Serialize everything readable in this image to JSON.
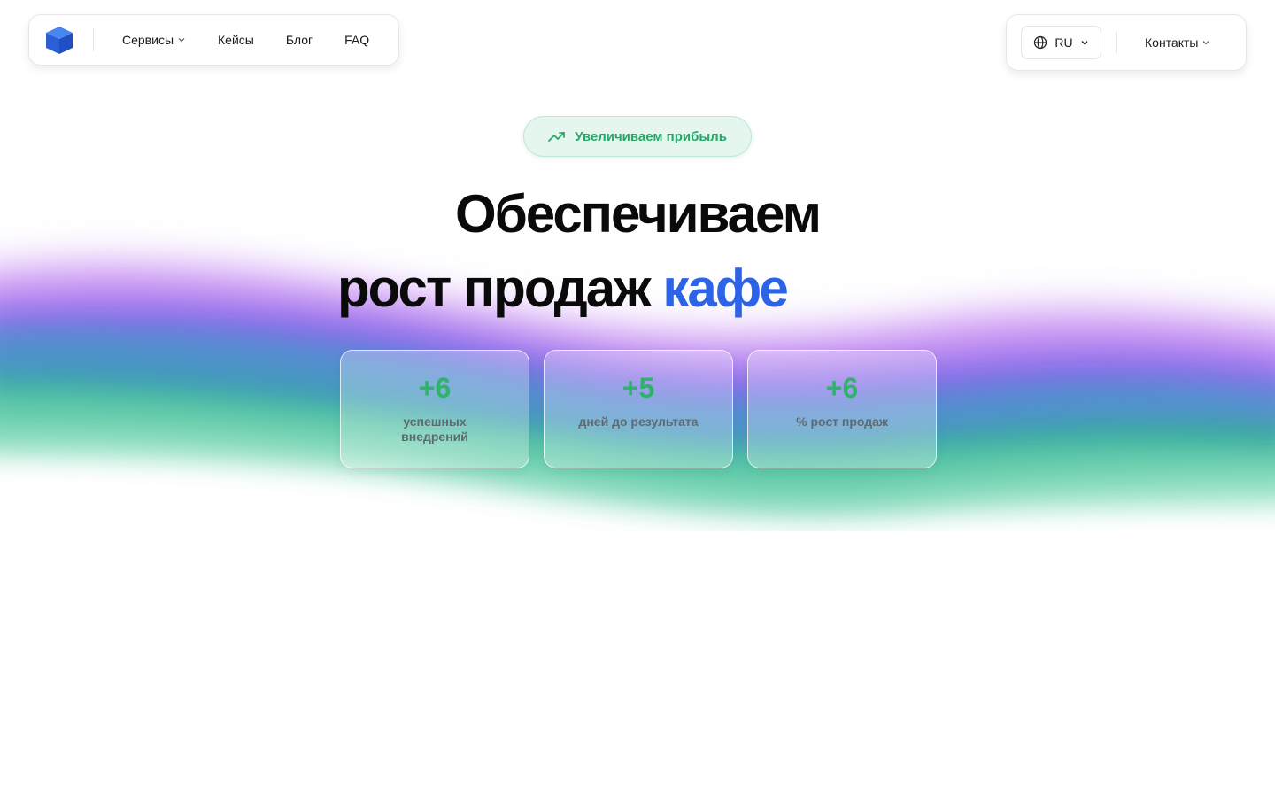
{
  "nav": {
    "logo_icon": "cube-logo",
    "links": [
      {
        "label": "Сервисы",
        "has_dropdown": true
      },
      {
        "label": "Кейсы"
      },
      {
        "label": "Блог"
      },
      {
        "label": "FAQ"
      }
    ]
  },
  "nav_right": {
    "language": "RU",
    "contacts_label": "Контакты"
  },
  "hero": {
    "badge": "Увеличиваем прибыль",
    "title_line1": "Обеспечиваем",
    "title_line2": "рост продаж",
    "title_accent": "кафе"
  },
  "stats": [
    {
      "value": "+6",
      "label": "успешных внедрений"
    },
    {
      "value": "+5",
      "label": "дней до результата"
    },
    {
      "value": "+6",
      "label": "% рост продаж"
    }
  ],
  "colors": {
    "accent_blue": "#2d63e6",
    "accent_green": "#2fb36a",
    "badge_bg": "#e4f6ee"
  }
}
